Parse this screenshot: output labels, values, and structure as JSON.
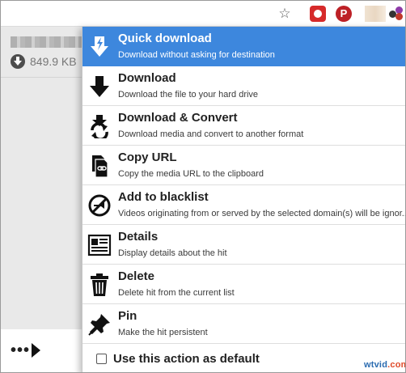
{
  "background_panel": {
    "size": "849.9 KB"
  },
  "menu": {
    "items": [
      {
        "title": "Quick download",
        "desc": "Download without asking for destination",
        "icon": "quick-download-icon"
      },
      {
        "title": "Download",
        "desc": "Download the file to your hard drive",
        "icon": "download-arrow-icon"
      },
      {
        "title": "Download & Convert",
        "desc": "Download media and convert to another format",
        "icon": "download-convert-icon"
      },
      {
        "title": "Copy URL",
        "desc": "Copy the media URL to the clipboard",
        "icon": "copy-url-icon"
      },
      {
        "title": "Add to blacklist",
        "desc": "Videos originating from or served by the selected domain(s) will be ignor...",
        "icon": "blacklist-icon"
      },
      {
        "title": "Details",
        "desc": "Display details about the hit",
        "icon": "details-icon"
      },
      {
        "title": "Delete",
        "desc": "Delete hit from the current list",
        "icon": "trash-icon"
      },
      {
        "title": "Pin",
        "desc": "Make the hit persistent",
        "icon": "pin-icon"
      }
    ],
    "default_label": "Use this action as default",
    "default_checked": false
  },
  "colors": {
    "highlight": "#3d87dd"
  },
  "watermark": {
    "text_a": "wtvid",
    "text_b": ".com"
  }
}
